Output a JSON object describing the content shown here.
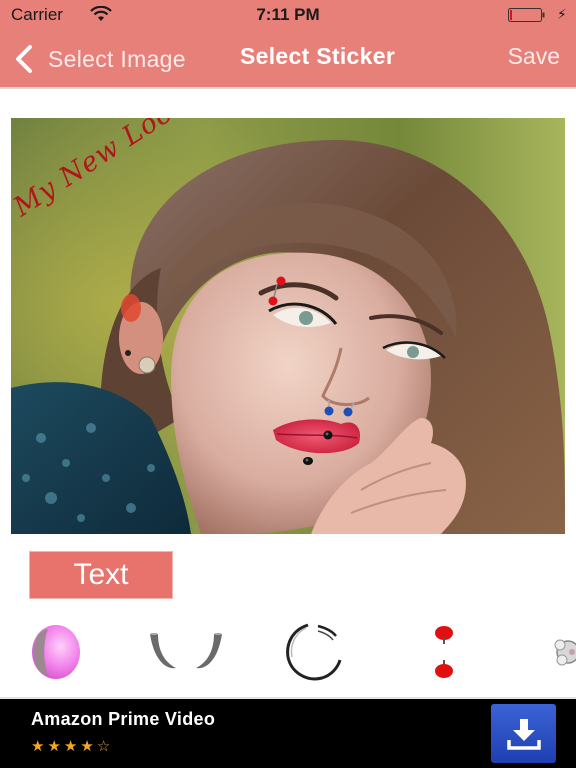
{
  "status_bar": {
    "carrier": "Carrier",
    "time": "7:11 PM",
    "wifi_icon": "wifi-icon",
    "battery_icon": "battery-low-icon",
    "charging_icon": "charging-bolt-icon",
    "charging_glyph": "⚡",
    "battery_level": 0.05
  },
  "nav": {
    "back_label": "Select Image",
    "back_icon": "chevron-left-icon",
    "title": "Select Sticker",
    "save_label": "Save"
  },
  "canvas": {
    "caption_sticker": "My New Look",
    "applied_stickers": [
      {
        "name": "eyebrow-piercing-red",
        "color": "#e0101a"
      },
      {
        "name": "nose-ring-blue-left",
        "color": "#1d4fb8"
      },
      {
        "name": "nose-ring-blue-right",
        "color": "#1d4fb8"
      },
      {
        "name": "lip-stud-black",
        "color": "#111111"
      },
      {
        "name": "chin-stud-black",
        "color": "#111111"
      }
    ]
  },
  "text_button": {
    "label": "Text"
  },
  "sticker_strip": {
    "items": [
      {
        "name": "pink-plug-sticker",
        "color": "#f07be8"
      },
      {
        "name": "horn-hoops-sticker",
        "color": "#666666"
      },
      {
        "name": "silver-hoop-sticker",
        "color": "#222222"
      },
      {
        "name": "red-barbell-sticker",
        "color": "#e01010"
      },
      {
        "name": "crystal-stud-sticker",
        "color": "#bbbbbb"
      }
    ]
  },
  "ad": {
    "title": "Amazon Prime Video",
    "rating": 4,
    "rating_max": 5,
    "stars": [
      "★",
      "★",
      "★",
      "★",
      "☆"
    ],
    "download_icon": "download-icon"
  },
  "colors": {
    "accent": "#E8807A",
    "text_button": "#E8726C",
    "ad_background": "#000000",
    "download_button": "#2b4fc4",
    "star": "#f5a623"
  }
}
